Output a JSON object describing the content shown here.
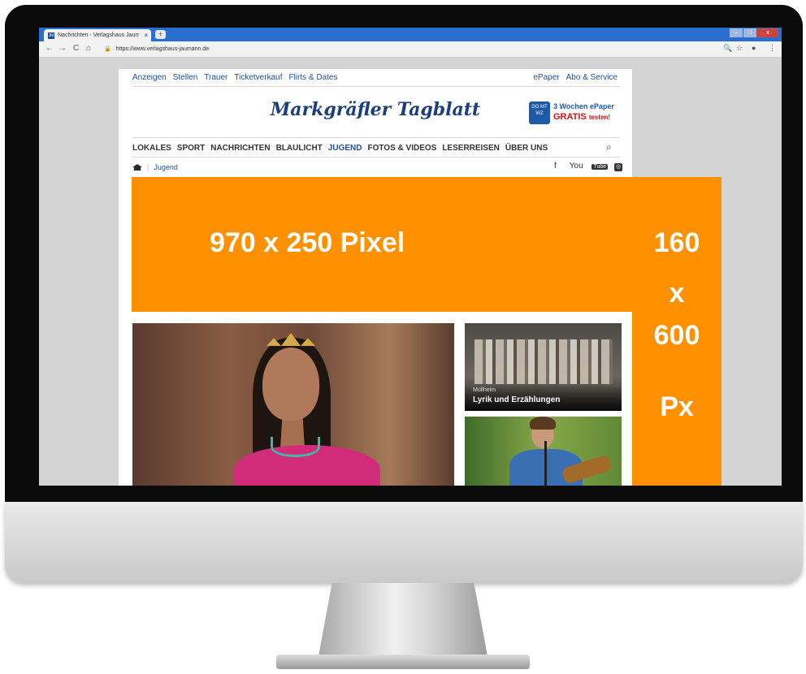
{
  "browser": {
    "tab_title": "Nachrichten - Verlagshaus Jaumann",
    "tab_close": "×",
    "new_tab": "+",
    "nav_back": "←",
    "nav_forward": "→",
    "nav_reload": "C",
    "nav_home": "⌂",
    "url": "https://www.verlagshaus-jaumann.de",
    "window_min": "–",
    "window_max": "□",
    "window_close": "x"
  },
  "site": {
    "top_nav": [
      "Anzeigen",
      "Stellen",
      "Trauer",
      "Ticketverkauf",
      "Flirts & Dates"
    ],
    "top_nav_right": [
      "ePaper",
      "Abo & Service"
    ],
    "logo": "Markgräfler Tagblatt",
    "promo": {
      "badge": "DO MT WZ",
      "line1": "3 Wochen ePaper",
      "line2": "GRATIS",
      "line2_suffix": "testen!"
    },
    "main_nav": [
      "LOKALES",
      "SPORT",
      "NACHRICHTEN",
      "BLAULICHT",
      "JUGEND",
      "FOTOS & VIDEOS",
      "LESERREISEN",
      "ÜBER UNS"
    ],
    "main_nav_active": "JUGEND",
    "breadcrumb": "Jugend",
    "social": {
      "facebook": "f",
      "youtube_you": "You",
      "youtube_tube": "Tube",
      "instagram": "◎"
    }
  },
  "articles": [
    {
      "location": "Müllheim",
      "headline": "Lyrik und Erzählungen"
    }
  ],
  "ads": {
    "leaderboard": "970 x 250 Pixel",
    "skyscraper": [
      "160",
      "x",
      "600",
      "Px"
    ],
    "color": "#ff9100"
  }
}
